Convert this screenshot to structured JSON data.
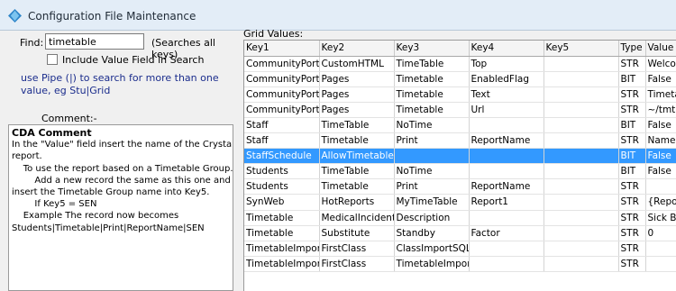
{
  "window": {
    "title": "Configuration File Maintenance"
  },
  "search": {
    "find_label": "Find:",
    "find_value": "timetable",
    "scope_note": "(Searches all keys)",
    "include_value_label": "Include Value Field  in Search",
    "include_value_checked": false,
    "pipe_hint": "use Pipe (|) to search for more than one value, eg Stu|Grid"
  },
  "comment": {
    "label": "Comment:-",
    "title": "CDA Comment",
    "lines": [
      "In the \"Value\" field insert the name of the Crystal",
      "report.",
      "    To use the report based on a Timetable Group.",
      "        Add a new record the same as this one and",
      "insert the Timetable Group name into Key5.",
      "        If Key5 = SEN",
      "    Example The record now becomes",
      "Students|Timetable|Print|ReportName|SEN"
    ]
  },
  "grid": {
    "label": "Grid Values:",
    "columns": [
      "Key1",
      "Key2",
      "Key3",
      "Key4",
      "Key5",
      "Type",
      "Value"
    ],
    "selected_row": 6,
    "rows": [
      [
        "CommunityPortal",
        "CustomHTML",
        "TimeTable",
        "Top",
        "",
        "STR",
        "Welcom"
      ],
      [
        "CommunityPortal",
        "Pages",
        "Timetable",
        "EnabledFlag",
        "",
        "BIT",
        "False"
      ],
      [
        "CommunityPortal",
        "Pages",
        "Timetable",
        "Text",
        "",
        "STR",
        "Timetal"
      ],
      [
        "CommunityPortal",
        "Pages",
        "Timetable",
        "Url",
        "",
        "STR",
        "~/tmtb"
      ],
      [
        "Staff",
        "TimeTable",
        "NoTime",
        "",
        "",
        "BIT",
        "False"
      ],
      [
        "Staff",
        "Timetable",
        "Print",
        "ReportName",
        "",
        "STR",
        "Name of"
      ],
      [
        "StaffSchedule",
        "AllowTimetabledC",
        "",
        "",
        "",
        "BIT",
        "False"
      ],
      [
        "Students",
        "TimeTable",
        "NoTime",
        "",
        "",
        "BIT",
        "False"
      ],
      [
        "Students",
        "Timetable",
        "Print",
        "ReportName",
        "",
        "STR",
        ""
      ],
      [
        "SynWeb",
        "HotReports",
        "MyTimeTable",
        "Report1",
        "",
        "STR",
        "{Repor"
      ],
      [
        "Timetable",
        "MedicalIncident",
        "Description",
        "",
        "",
        "STR",
        "Sick Ba"
      ],
      [
        "Timetable",
        "Substitute",
        "Standby",
        "Factor",
        "",
        "STR",
        "0"
      ],
      [
        "TimetableImport",
        "FirstClass",
        "ClassImportSQL",
        "",
        "",
        "STR",
        ""
      ],
      [
        "TimetableImport",
        "FirstClass",
        "TimetableImportS",
        "",
        "",
        "STR",
        ""
      ]
    ]
  }
}
